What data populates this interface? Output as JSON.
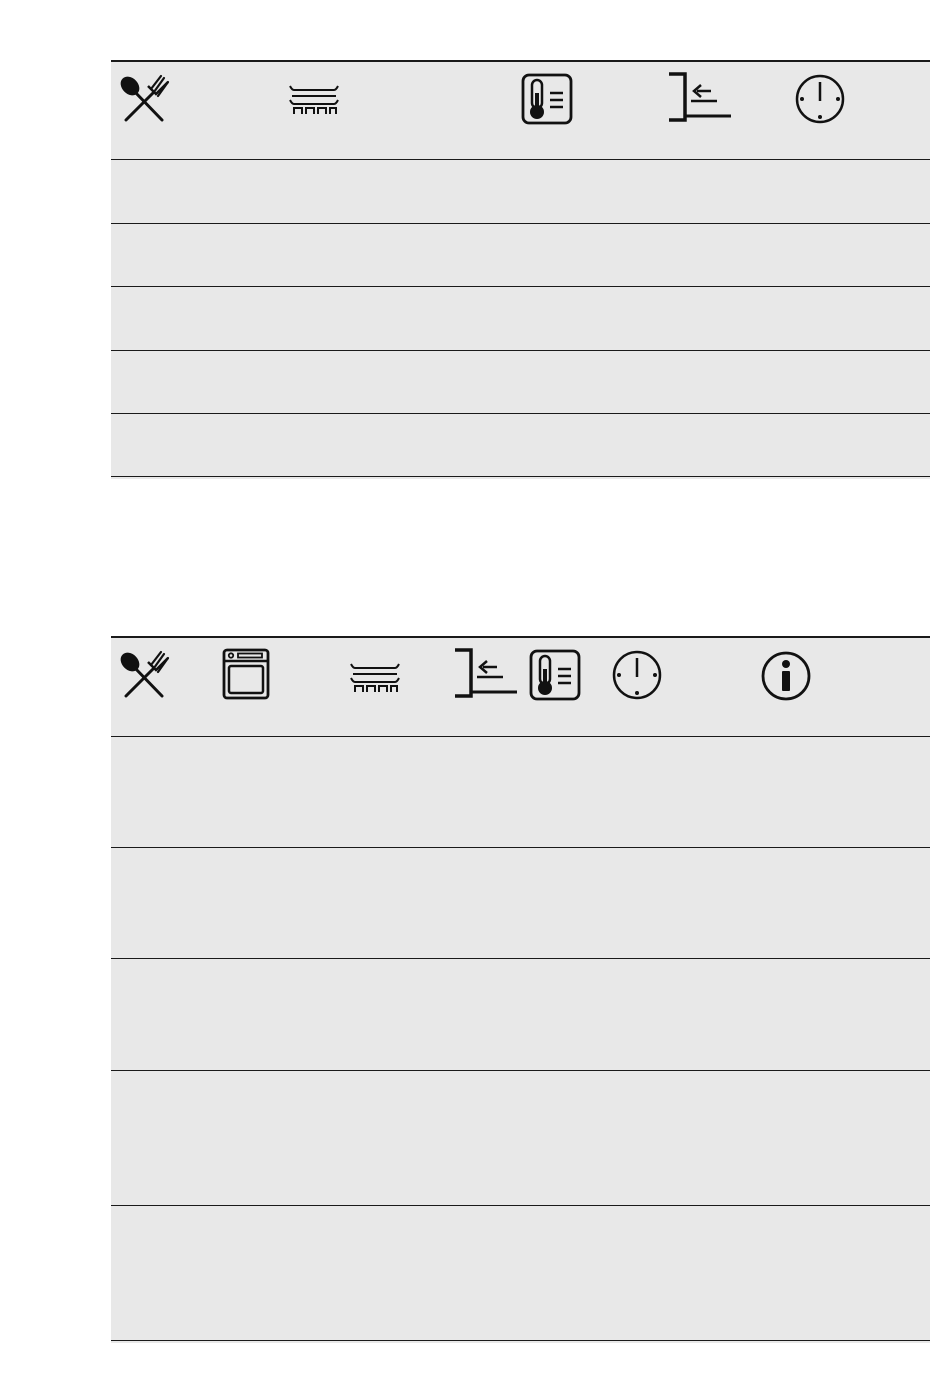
{
  "table1": {
    "header_icons": [
      "cutlery-icon",
      "shelf-rack-icon",
      "thermometer-icon",
      "shelf-position-icon",
      "clock-icon"
    ],
    "rows": 5
  },
  "table2": {
    "header_icons": [
      "cutlery-icon",
      "oven-icon",
      "shelf-rack-icon",
      "shelf-position-icon",
      "thermometer-icon",
      "clock-icon",
      "info-icon"
    ],
    "rows": 5
  }
}
